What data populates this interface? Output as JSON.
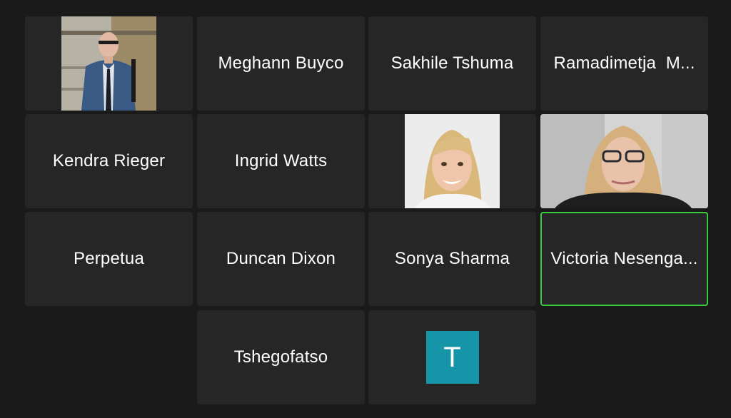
{
  "participants": [
    {
      "type": "video",
      "subject": "man-in-suit-photo"
    },
    {
      "type": "name",
      "name": "Meghann Buyco"
    },
    {
      "type": "name",
      "name": "Sakhile Tshuma"
    },
    {
      "type": "name",
      "name": "Ramadimetja  M..."
    },
    {
      "type": "name",
      "name": "Kendra Rieger"
    },
    {
      "type": "name",
      "name": "Ingrid Watts"
    },
    {
      "type": "video",
      "subject": "smiling-blonde-woman-photo"
    },
    {
      "type": "video",
      "subject": "woman-with-glasses-video"
    },
    {
      "type": "name",
      "name": "Perpetua"
    },
    {
      "type": "name",
      "name": "Duncan Dixon"
    },
    {
      "type": "name",
      "name": "Sonya Sharma"
    },
    {
      "type": "name",
      "name": "Victoria Nesenga...",
      "active_speaker": true
    },
    {
      "type": "name",
      "name": "Tshegofatso"
    },
    {
      "type": "avatar",
      "initial": "T",
      "color": "#1795a8"
    }
  ],
  "colors": {
    "background": "#1a1a1a",
    "tile": "#262626",
    "active_speaker_border": "#3ccb3c",
    "text": "#ffffff"
  }
}
